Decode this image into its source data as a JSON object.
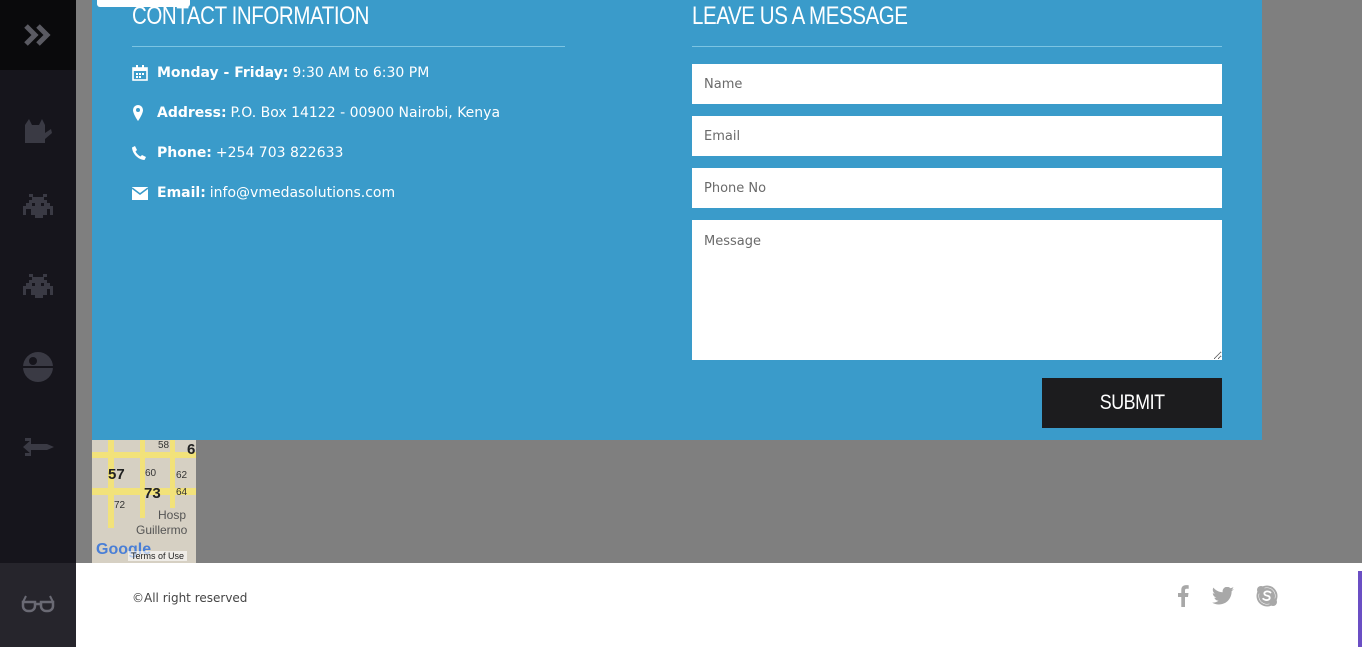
{
  "sidebar": {
    "items": [
      {
        "icon": "double-chevron-right-icon"
      },
      {
        "icon": "cat-icon"
      },
      {
        "icon": "space-invader-icon"
      },
      {
        "icon": "space-invader-icon"
      },
      {
        "icon": "death-star-icon"
      },
      {
        "icon": "spaceship-icon"
      },
      {
        "icon": "glasses-icon"
      }
    ]
  },
  "contact": {
    "title": "CONTACT INFORMATION",
    "rows": [
      {
        "icon": "calendar-icon",
        "label": "Monday - Friday:",
        "value": "9:30 AM to 6:30 PM"
      },
      {
        "icon": "map-marker-icon",
        "label": "Address:",
        "value": "P.O. Box 14122 - 00900 Nairobi, Kenya"
      },
      {
        "icon": "phone-icon",
        "label": "Phone:",
        "value": "+254 703 822633"
      },
      {
        "icon": "envelope-icon",
        "label": "Email:",
        "value": "info@vmedasolutions.com"
      }
    ]
  },
  "form": {
    "title": "LEAVE US A MESSAGE",
    "name_placeholder": "Name",
    "email_placeholder": "Email",
    "phone_placeholder": "Phone No",
    "message_placeholder": "Message",
    "submit_label": "SUBMIT"
  },
  "map": {
    "labels": [
      "58",
      "6",
      "57",
      "60",
      "62",
      "73",
      "64",
      "72",
      "Hosp",
      "Guillermo"
    ],
    "terms": "Terms of Use",
    "logo": "Google"
  },
  "footer": {
    "copyright": "©All right reserved",
    "social": [
      "facebook-icon",
      "twitter-icon",
      "skype-icon"
    ]
  },
  "colors": {
    "panel": "#3a9bca",
    "sidebar": "#16151c",
    "submit": "#1c1c1e",
    "overlay": "#7f7f7f"
  }
}
